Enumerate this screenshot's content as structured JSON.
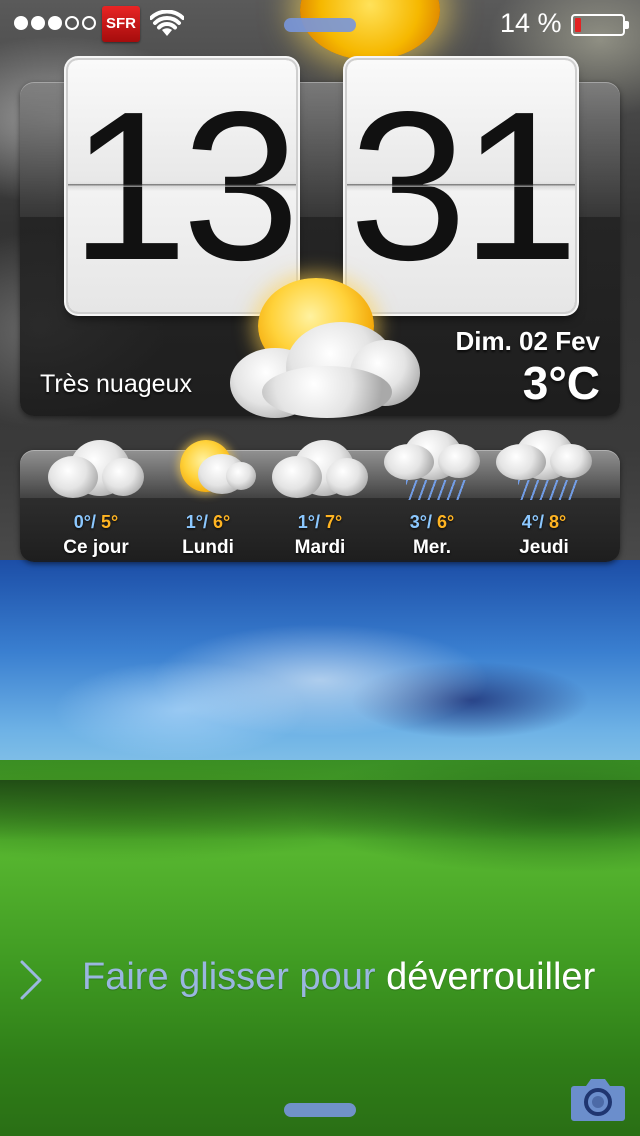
{
  "status_bar": {
    "signal_bars": [
      true,
      true,
      true,
      false,
      false
    ],
    "carrier": "SFR",
    "wifi_icon": "wifi-icon",
    "battery_percent": "14 %",
    "battery_level": 0.14,
    "battery_color": "#e32222"
  },
  "clock": {
    "hours": "13",
    "minutes": "31"
  },
  "weather": {
    "date": "Dim. 02 Fev",
    "temperature": "3°C",
    "condition": "Très nuageux",
    "icon": "sun-cloud-icon"
  },
  "forecast": [
    {
      "low": "0°",
      "high": "5°",
      "day": "Ce jour",
      "icon": "cloud-icon"
    },
    {
      "low": "1°",
      "high": "6°",
      "day": "Lundi",
      "icon": "sun-cloud-icon"
    },
    {
      "low": "1°",
      "high": "7°",
      "day": "Mardi",
      "icon": "cloud-icon"
    },
    {
      "low": "3°",
      "high": "6°",
      "day": "Mer.",
      "icon": "rain-cloud-icon"
    },
    {
      "low": "4°",
      "high": "8°",
      "day": "Jeudi",
      "icon": "rain-cloud-icon"
    }
  ],
  "unlock": {
    "text_dim": "Faire glisser pour ",
    "text_bright": "déverrouiller",
    "chevron_icon": "chevron-right-icon"
  },
  "camera": {
    "icon": "camera-icon"
  },
  "colors": {
    "temp_low": "#8cc8ff",
    "temp_high": "#ffb422",
    "handle": "#7896dc"
  }
}
